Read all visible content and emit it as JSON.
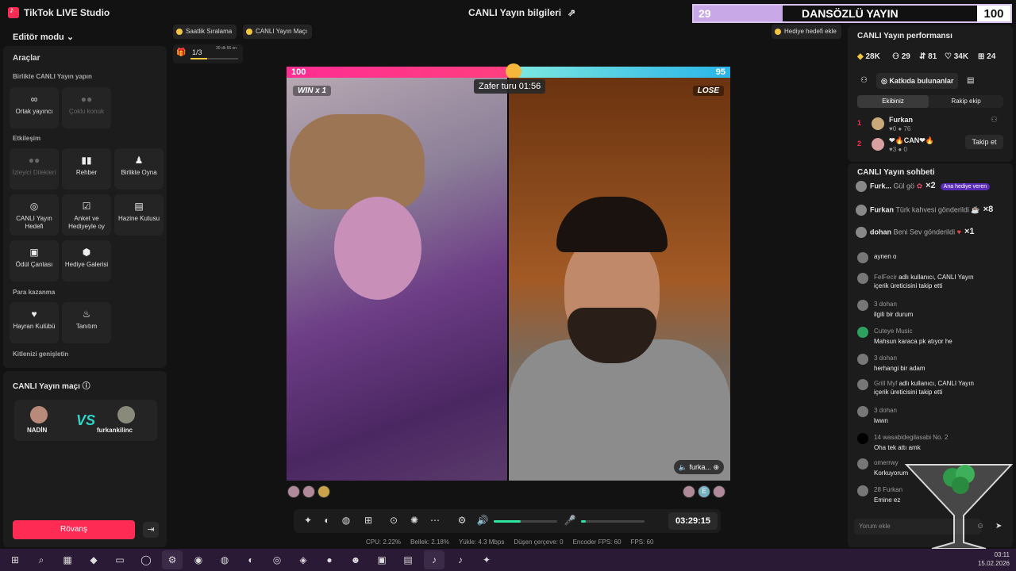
{
  "app": {
    "name": "TikTok LIVE Studio",
    "window_title": "CANLI Yayın bilgileri",
    "overlay": {
      "left": "29",
      "middle": "DANSÖZLÜ YAYIN",
      "right": "100"
    }
  },
  "left": {
    "editor_mode": "Editör modu",
    "tools_title": "Araçlar",
    "section_cohost": "Birlikte CANLI Yayın yapın",
    "section_engagement": "Etkileşim",
    "section_monetize": "Para kazanma",
    "section_audience": "Kitlenizi genişletin",
    "tools": [
      {
        "label": "Ortak yayıncı",
        "icon": "link-icon"
      },
      {
        "label": "Çoklu konuk",
        "icon": "users-icon"
      },
      {
        "label": "İzleyici Dilekleri",
        "icon": "users-icon"
      },
      {
        "label": "Rehber",
        "icon": "book-icon"
      },
      {
        "label": "Birlikte Oyna",
        "icon": "gamepad-icon"
      },
      {
        "label": "CANLI Yayın Hedefi",
        "icon": "target-icon"
      },
      {
        "label": "Anket ve Hediyeyle oy",
        "icon": "poll-icon"
      },
      {
        "label": "Hazine Kutusu",
        "icon": "chest-icon"
      },
      {
        "label": "Ödül Çantası",
        "icon": "bag-icon"
      },
      {
        "label": "Hediye Galerisi",
        "icon": "gift-icon"
      },
      {
        "label": "Hayran Kulübü",
        "icon": "heart-icon"
      },
      {
        "label": "Tanıtım",
        "icon": "flame-icon"
      }
    ],
    "match_title": "CANLI Yayın maçı",
    "player_left": "NADİN",
    "player_right": "furkankilinc",
    "vs": "VS",
    "rematch_label": "Rövanş"
  },
  "stage": {
    "chips": [
      "Saatlik Sıralama",
      "CANLI Yayın Maçı",
      "Hediye hedefi ekle"
    ],
    "goal_progress": "1/3",
    "goal_time": "30 dk 56 sn",
    "score_left": "100",
    "score_right": "95",
    "round_timer": "Zafer turu 01:56",
    "tag_left": "WIN x 1",
    "tag_right": "LOSE",
    "right_name_tag": "furka...",
    "right_rank_letter": "E"
  },
  "controls": {
    "elapsed": "03:29:15",
    "volume": 0.42,
    "mic": 0.08
  },
  "stats": [
    "CPU: 2.22%",
    "Bellek: 2.18%",
    "Yükle: 4.3 Mbps",
    "Düşen çerçeve: 0",
    "Encoder FPS: 60",
    "FPS: 60"
  ],
  "performance": {
    "title": "CANLI Yayın performansı",
    "metrics": [
      "28K",
      "29",
      "81",
      "34K",
      "24"
    ],
    "contrib_label": "Katkıda bulunanlar",
    "tab_team": "Ekibiniz",
    "tab_rival": "Rakip ekip",
    "ranking": [
      {
        "rank": "1",
        "name": "Furkan",
        "sub": "♥0 ● 76"
      },
      {
        "rank": "2",
        "name": "❤🔥CAN❤🔥",
        "sub": "♥3 ● 0"
      }
    ],
    "follow_label": "Takip et"
  },
  "chat": {
    "title": "CANLI Yayın sohbeti",
    "gifts": [
      {
        "user": "Furk...",
        "text": "Gül gö",
        "count": "×2",
        "badge": "Ana hediye veren"
      },
      {
        "user": "Furkan",
        "text": "Türk kahvesi gönderildi",
        "count": "×8"
      },
      {
        "user": "dohan",
        "text": "Beni Sev gönderildi",
        "count": "×1"
      }
    ],
    "messages": [
      {
        "user": "",
        "text": "aynen o"
      },
      {
        "user": "FelFecir",
        "text": "adlı kullanıcı, CANLI Yayın",
        "text2": "içerik üreticisini takip etti"
      },
      {
        "user": "3 dohan",
        "text": "ilgili bir durum"
      },
      {
        "user": "Cuteye Music",
        "text": "Mahsun karaca pk atıyor he"
      },
      {
        "user": "3 dohan",
        "text": "herhangi bir adam"
      },
      {
        "user": "Grill Myf",
        "text": "adlı kullanıcı, CANLI Yayın",
        "text2": "içerik üreticisini takip etti"
      },
      {
        "user": "3 dohan",
        "text": "lwwn"
      },
      {
        "user": "14 wasabidegilasabi No. 2",
        "text": "Oha tek attı amk"
      },
      {
        "user": "omerrwy",
        "text": "Korkuyorum"
      },
      {
        "user": "28 Furkan",
        "text": "Emine ez"
      }
    ],
    "placeholder": "Yorum ekle"
  },
  "taskbar": {
    "time": "03:11",
    "date": "15.02.2026"
  }
}
